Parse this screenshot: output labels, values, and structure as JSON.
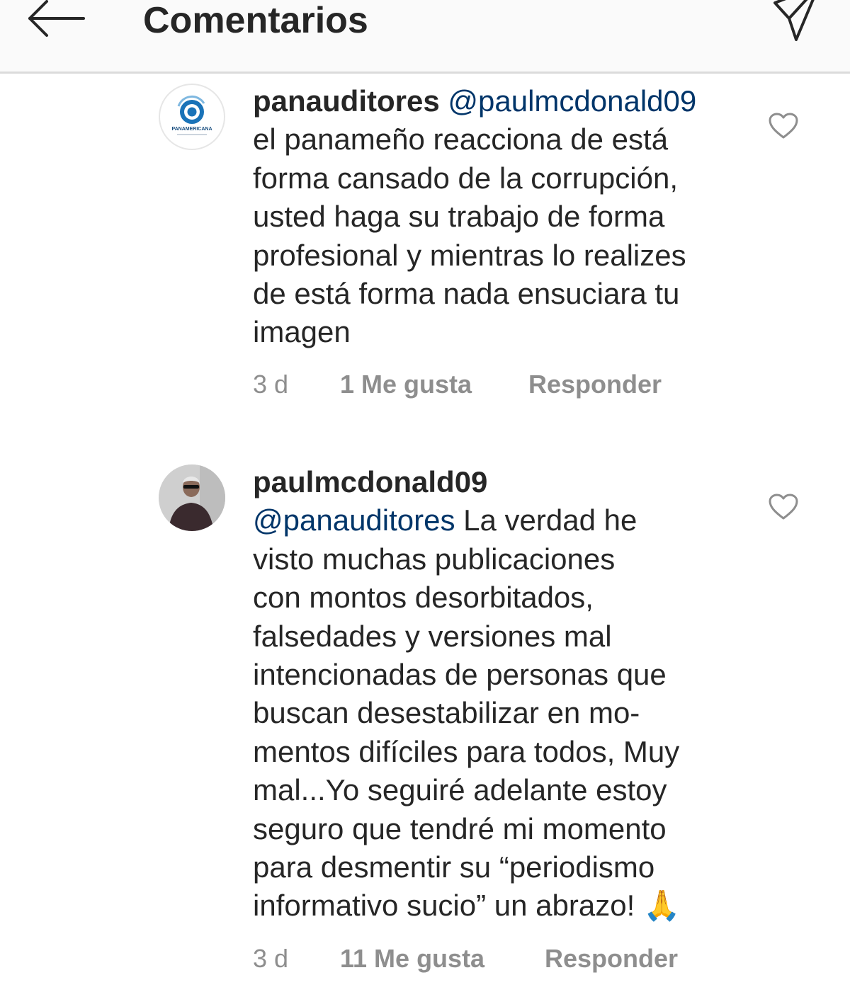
{
  "header": {
    "title": "Comentarios",
    "back_icon": "arrow-left-icon",
    "send_icon": "paper-plane-icon"
  },
  "comments": [
    {
      "username": "panauditores",
      "mention": "@paulmcdonald09",
      "text": "el panameño reacciona de está\nforma cansado de la corrupción,\nusted haga su trabajo de forma\nprofesional y mientras lo realizes\nde está forma nada ensuciara tu\nimagen",
      "avatar_text": "PANAMERICANA",
      "time": "3 d",
      "likes": "1 Me gusta",
      "reply": "Responder",
      "like_icon": "heart-outline-icon"
    },
    {
      "username": "paulmcdonald09",
      "mention": "@panauditores",
      "text": "La verdad he\nvisto muchas publicaciones\ncon montos desorbitados,\nfalsedades y versiones mal\nintencionadas de personas que\nbuscan desestabilizar en mo-\nmentos difíciles para todos, Muy\nmal...Yo seguiré adelante estoy\nseguro que tendré mi momento\npara desmentir su “periodismo\ninformativo sucio” un abrazo!",
      "emoji": "🙏",
      "time": "3 d",
      "likes": "11 Me gusta",
      "reply": "Responder",
      "like_icon": "heart-outline-icon"
    }
  ],
  "colors": {
    "text": "#262626",
    "mention": "#003569",
    "meta": "#8e8e8e",
    "header_bg": "#fafafa",
    "divider": "#dbdbdb"
  }
}
